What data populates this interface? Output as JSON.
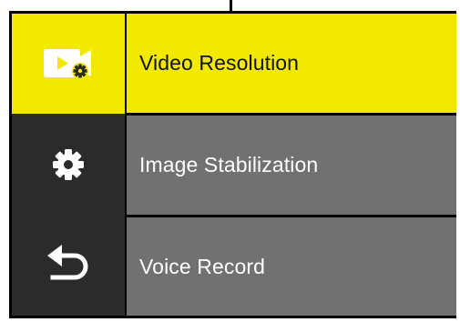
{
  "sidebar": {
    "items": [
      {
        "icon": "video-settings-icon",
        "active": true
      },
      {
        "icon": "gear-icon",
        "active": false
      },
      {
        "icon": "back-arrow-icon",
        "active": false
      }
    ]
  },
  "menu": {
    "items": [
      {
        "label": "Video Resolution",
        "active": true
      },
      {
        "label": "Image Stabilization",
        "active": false
      },
      {
        "label": "Voice Record",
        "active": false
      }
    ]
  },
  "colors": {
    "accent": "#f2e800",
    "sidebar_bg": "#2b2b2b",
    "item_bg": "#717171",
    "frame": "#000000"
  }
}
